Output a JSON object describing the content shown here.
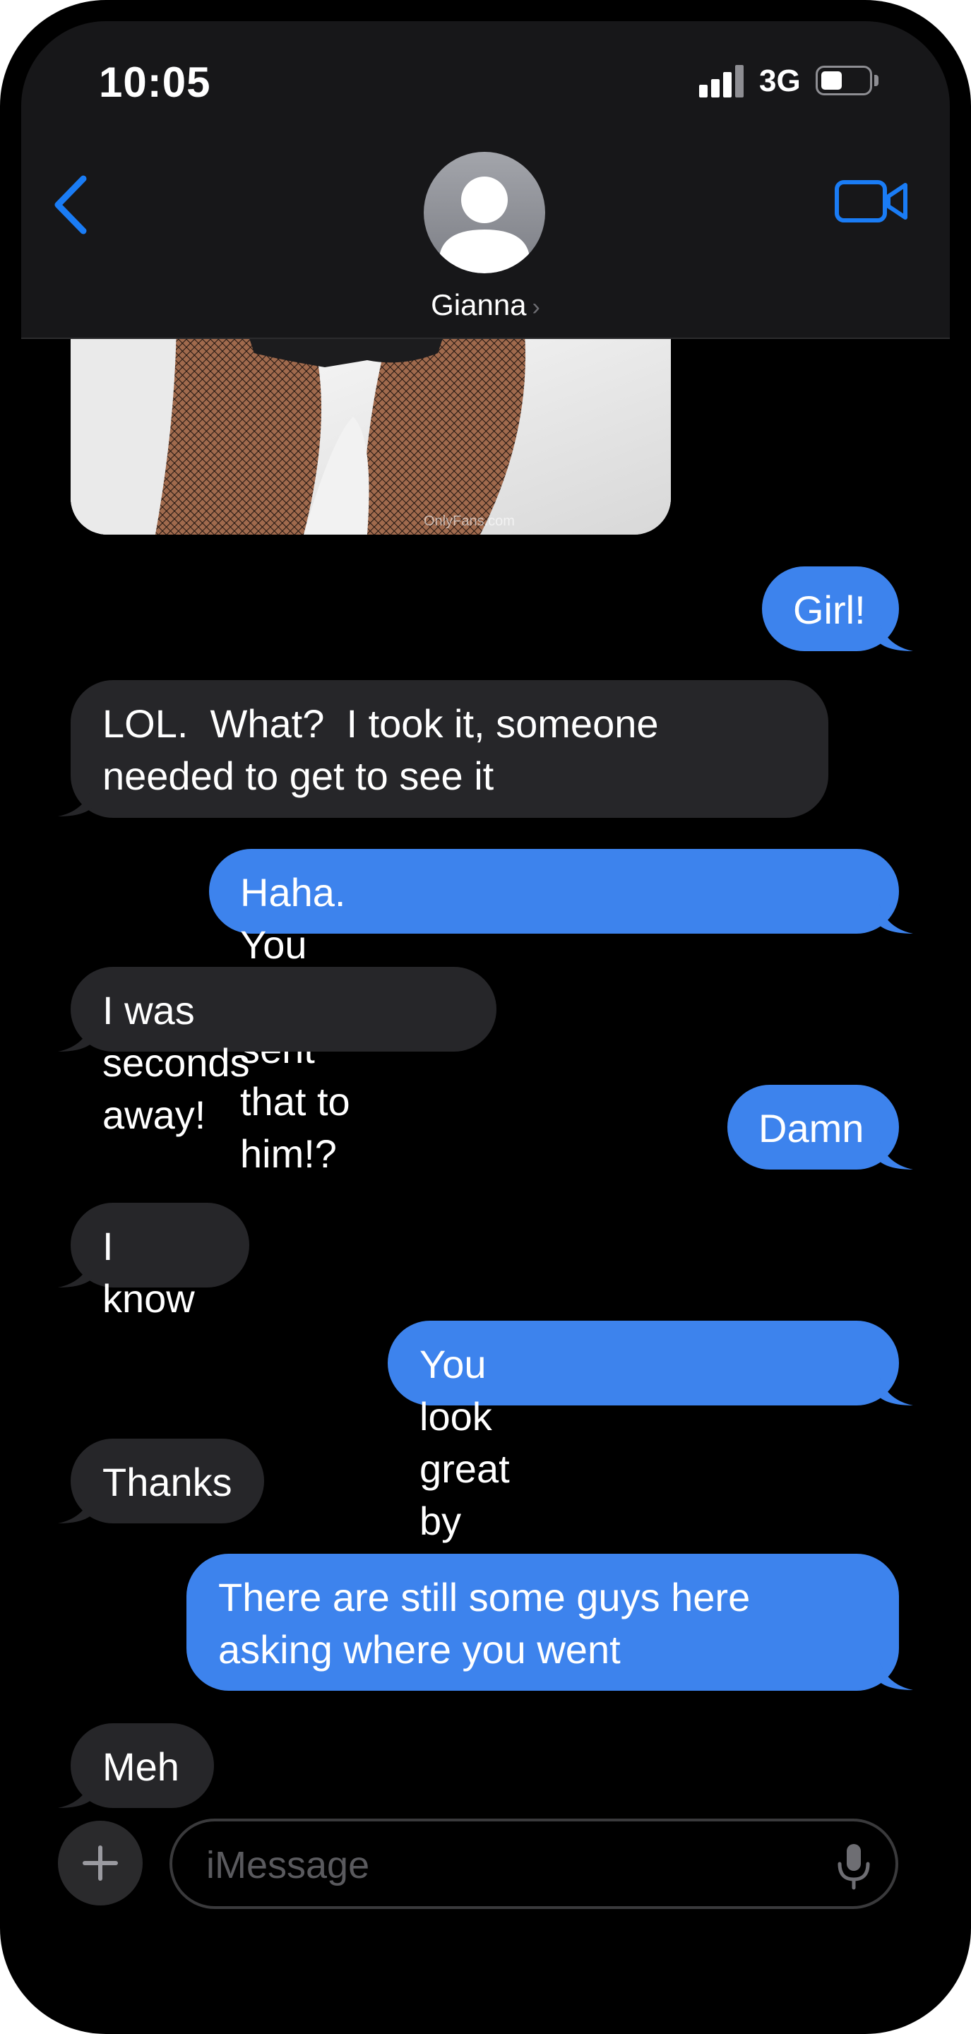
{
  "status_bar": {
    "time": "10:05",
    "network": "3G",
    "battery_level": 0.45
  },
  "header": {
    "contact_name": "Gianna",
    "back_icon": "chevron-left-icon",
    "video_icon": "video-camera-icon",
    "avatar_icon": "person-silhouette-icon"
  },
  "photo": {
    "watermark": "OnlyFans.com"
  },
  "messages": [
    {
      "from": "me",
      "text": "Girl!"
    },
    {
      "from": "them",
      "text": "LOL.  What?  I took it, someone needed to get to see it"
    },
    {
      "from": "me",
      "text": "Haha.  You almost sent that to him!?"
    },
    {
      "from": "them",
      "text": "I was seconds away!"
    },
    {
      "from": "me",
      "text": "Damn"
    },
    {
      "from": "them",
      "text": "I know"
    },
    {
      "from": "me",
      "text": "You look great by the way"
    },
    {
      "from": "them",
      "text": "Thanks"
    },
    {
      "from": "me",
      "text": "There are still some guys here asking where you went"
    },
    {
      "from": "them",
      "text": "Meh"
    }
  ],
  "composer": {
    "placeholder": "iMessage",
    "add_icon": "plus-icon",
    "mic_icon": "microphone-icon"
  },
  "colors": {
    "sent_bubble": "#3d83ed",
    "received_bubble": "#262629",
    "accent": "#1a7cf5"
  }
}
